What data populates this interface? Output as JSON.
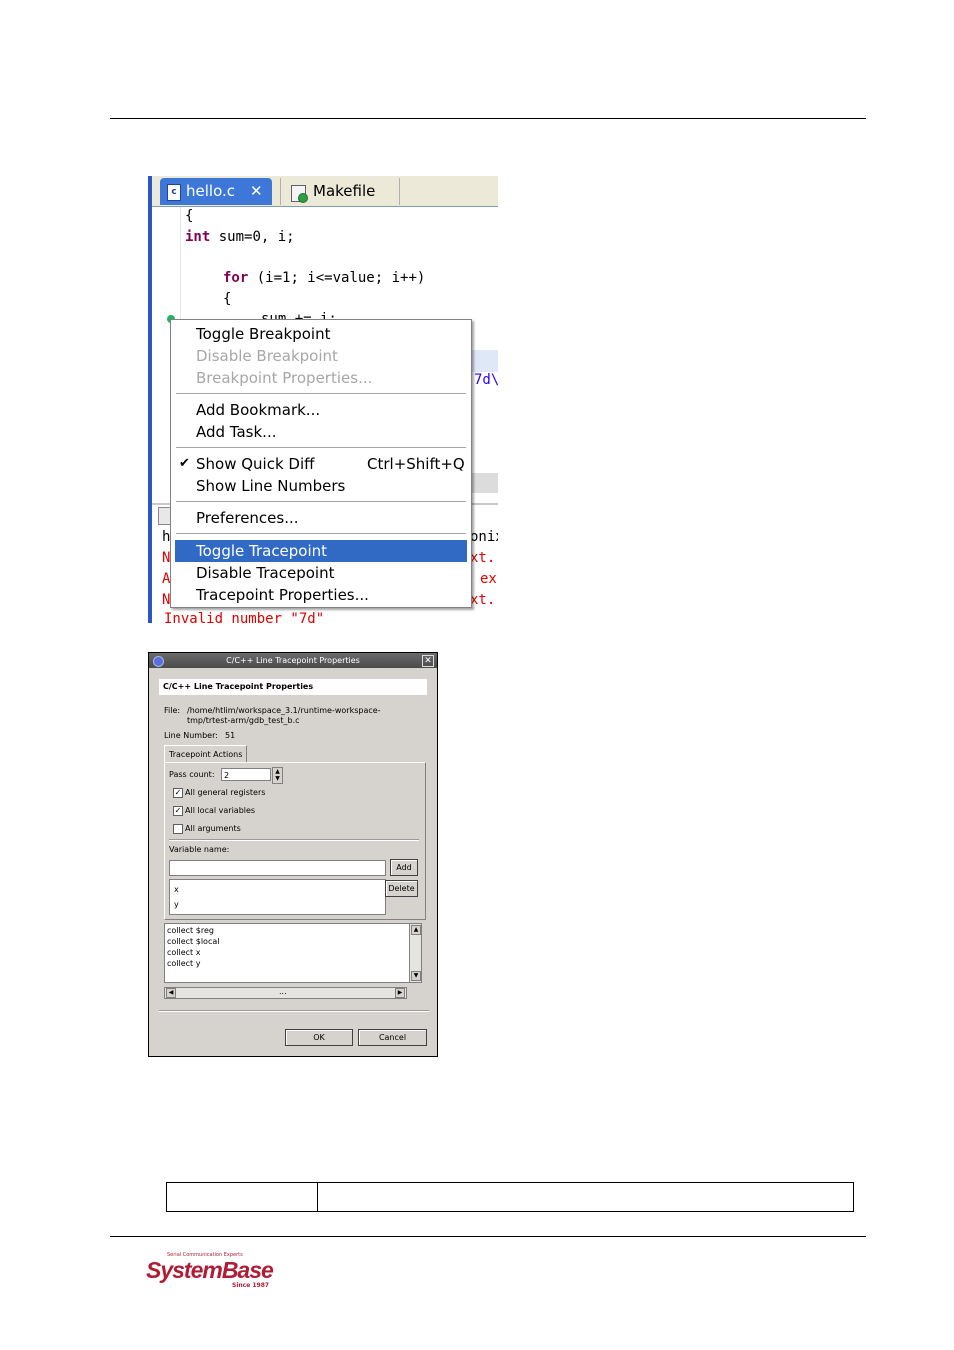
{
  "editor": {
    "tabs": [
      {
        "label": "hello.c",
        "icon": "c-file-icon",
        "active": true
      },
      {
        "label": "Makefile",
        "icon": "makefile-icon",
        "active": false
      }
    ],
    "code_lines": [
      {
        "text": "{"
      },
      {
        "kw": "int",
        "rest": " sum=0, i;"
      },
      {
        "kw": "for",
        "rest": " (i=1; i<=value; i++)"
      },
      {
        "text": "{"
      },
      {
        "text": "sum += i;"
      }
    ],
    "side_fragments": [
      "7d\\",
      "onix",
      "xt.",
      "ex",
      "xt."
    ],
    "bottom_fragments": [
      "h",
      "N",
      "A",
      "N"
    ],
    "bottom_last_line": "Invalid number \"7d\""
  },
  "context_menu": {
    "items": [
      {
        "label": "Toggle Breakpoint",
        "enabled": true
      },
      {
        "label": "Disable Breakpoint",
        "enabled": false
      },
      {
        "label": "Breakpoint Properties...",
        "enabled": false
      },
      {
        "label": "Add Bookmark...",
        "enabled": true
      },
      {
        "label": "Add Task...",
        "enabled": true
      },
      {
        "label": "Show Quick Diff",
        "enabled": true,
        "checked": true,
        "shortcut": "Ctrl+Shift+Q"
      },
      {
        "label": "Show Line Numbers",
        "enabled": true
      },
      {
        "label": "Preferences...",
        "enabled": true
      },
      {
        "label": "Toggle Tracepoint",
        "enabled": true,
        "selected": true
      },
      {
        "label": "Disable Tracepoint",
        "enabled": true
      },
      {
        "label": "Tracepoint Properties...",
        "enabled": true
      }
    ],
    "check_glyph": "✔"
  },
  "dialog": {
    "title": "C/C++ Line Tracepoint Properties",
    "header": "C/C++ Line Tracepoint Properties",
    "file_label": "File:",
    "file_path_1": "/home/htlim/workspace_3.1/runtime-workspace-",
    "file_path_2": "tmp/trtest-arm/gdb_test_b.c",
    "line_number_label": "Line Number:",
    "line_number": "51",
    "tab_label": "Tracepoint Actions",
    "pass_count_label": "Pass count:",
    "pass_count": "2",
    "checkboxes": [
      {
        "label": "All general registers",
        "checked": true
      },
      {
        "label": "All local variables",
        "checked": true
      },
      {
        "label": "All arguments",
        "checked": false
      }
    ],
    "variable_name_label": "Variable name:",
    "variable_name_value": "",
    "add_label": "Add",
    "delete_label": "Delete",
    "variables": [
      "x",
      "y"
    ],
    "actions": [
      "collect $reg",
      "collect $local",
      "collect x",
      "collect y"
    ],
    "hscroll_grip": "...",
    "ok_label": "OK",
    "cancel_label": "Cancel"
  },
  "logo": {
    "tagline": "Serial Communication Experts",
    "name": "SystemBase",
    "since": "Since 1987",
    "color": "#b01c34"
  }
}
